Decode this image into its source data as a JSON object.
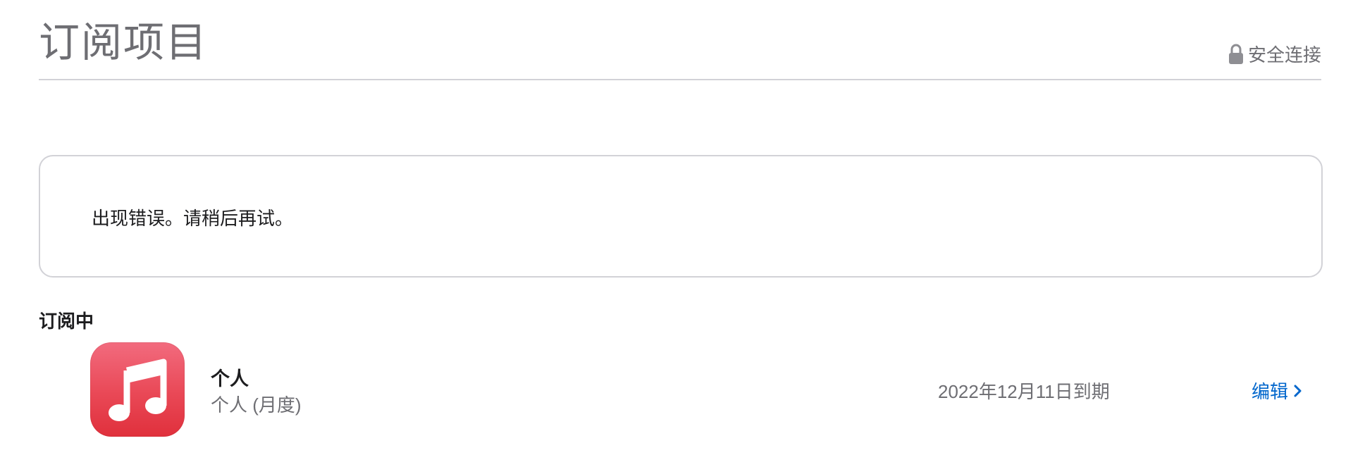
{
  "header": {
    "title": "订阅项目",
    "secure_label": "安全连接",
    "secure_icon": "lock-icon"
  },
  "error": {
    "message": "出现错误。请稍后再试。"
  },
  "active_section": {
    "title": "订阅中",
    "subscriptions": [
      {
        "icon": "music-note-icon",
        "name": "个人",
        "plan": "个人 (月度)",
        "expiry": "2022年12月11日到期",
        "edit_label": "编辑"
      }
    ]
  },
  "colors": {
    "link": "#0066cc",
    "icon_red": "#e94856",
    "muted_text": "#6e6e73"
  }
}
